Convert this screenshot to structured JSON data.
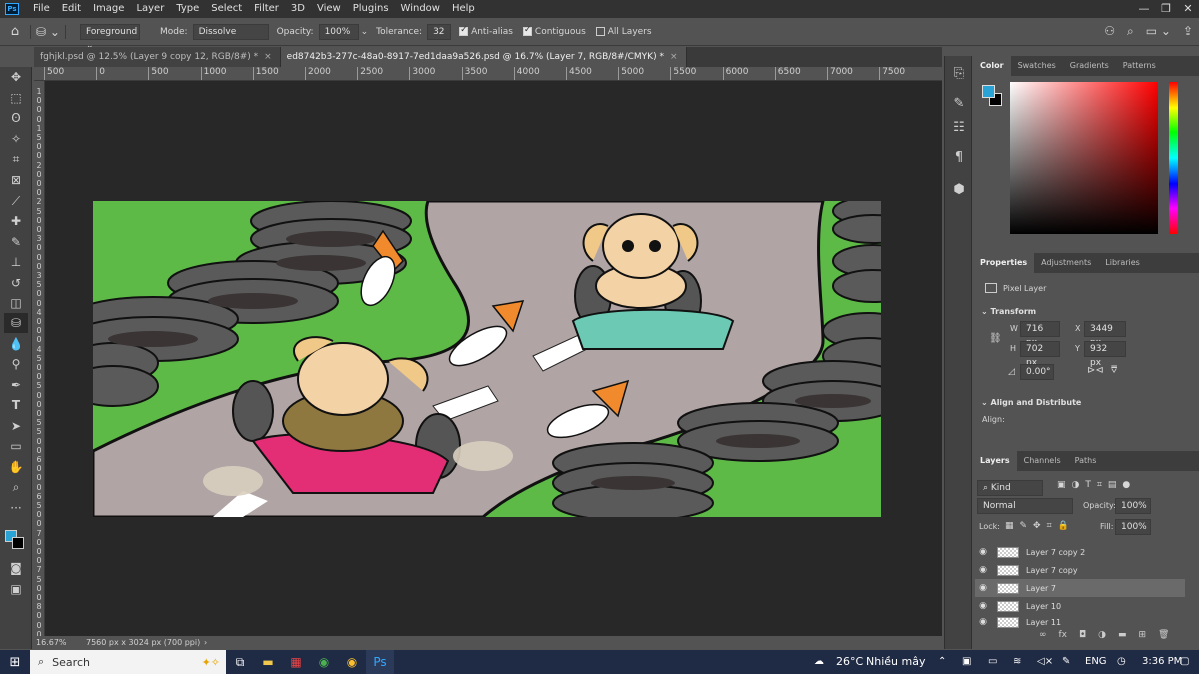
{
  "menu": {
    "logo": "Ps",
    "items": [
      "File",
      "Edit",
      "Image",
      "Layer",
      "Type",
      "Select",
      "Filter",
      "3D",
      "View",
      "Plugins",
      "Window",
      "Help"
    ],
    "window_controls": [
      "—",
      "❐",
      "✕"
    ]
  },
  "options": {
    "fill_source": "Foreground",
    "mode_label": "Mode:",
    "mode_value": "Dissolve",
    "opacity_label": "Opacity:",
    "opacity_value": "100%",
    "tolerance_label": "Tolerance:",
    "tolerance_value": "32",
    "anti_alias": "Anti-alias",
    "contiguous": "Contiguous",
    "all_layers": "All Layers"
  },
  "tabs": [
    {
      "label": "fghjkl.psd @ 12.5% (Layer 9 copy 12, RGB/8#) *",
      "close": "×"
    },
    {
      "label": "ed8742b3-277c-48a0-8917-7ed1daa9a526.psd @ 16.7% (Layer 7, RGB/8#/CMYK) *",
      "close": "×"
    }
  ],
  "ruler": {
    "h_ticks": [
      "500",
      "0",
      "500",
      "1000",
      "1500",
      "2000",
      "2500",
      "3000",
      "3500",
      "4000",
      "4500",
      "5000",
      "5500",
      "6000",
      "6500",
      "7000",
      "7500"
    ],
    "v_ticks": [
      "1",
      "0",
      "0",
      "0",
      "1",
      "5",
      "0",
      "0",
      "2",
      "0",
      "0",
      "0",
      "2",
      "5",
      "0",
      "0",
      "3",
      "0",
      "0",
      "0",
      "3",
      "5",
      "0",
      "0",
      "4",
      "0",
      "0",
      "0",
      "4",
      "5",
      "0",
      "0",
      "5",
      "0",
      "0",
      "0",
      "5",
      "5",
      "0",
      "0",
      "6",
      "0",
      "0",
      "0",
      "6",
      "5",
      "0",
      "0",
      "7",
      "0",
      "0",
      "0",
      "7",
      "5",
      "0",
      "0",
      "8",
      "0",
      "0",
      "0"
    ]
  },
  "status": {
    "zoom": "16.67%",
    "doc_size": "7560 px x 3024 px (700 ppi)",
    "arrow": "›"
  },
  "color_panel": {
    "tabs": [
      "Color",
      "Swatches",
      "Gradients",
      "Patterns"
    ],
    "fg_color": "#29a3d6",
    "bg_color": "#000000"
  },
  "properties": {
    "tabs": [
      "Properties",
      "Adjustments",
      "Libraries"
    ],
    "kind": "Pixel Layer",
    "transform_label": "Transform",
    "w_label": "W",
    "w_value": "716 px",
    "x_label": "X",
    "x_value": "3449 px",
    "h_label": "H",
    "h_value": "702 px",
    "y_label": "Y",
    "y_value": "932 px",
    "angle": "0.00°",
    "align_label": "Align and Distribute",
    "align_sub": "Align:"
  },
  "layers_panel": {
    "tabs": [
      "Layers",
      "Channels",
      "Paths"
    ],
    "filter_kind": "Kind",
    "blend_mode": "Normal",
    "opacity_label": "Opacity:",
    "opacity_value": "100%",
    "lock_label": "Lock:",
    "fill_label": "Fill:",
    "fill_value": "100%",
    "layers": [
      {
        "name": "Layer 7 copy 2"
      },
      {
        "name": "Layer 7 copy"
      },
      {
        "name": "Layer 7"
      },
      {
        "name": "Layer 10"
      },
      {
        "name": "Layer 11"
      }
    ],
    "footer_icons": [
      "∞",
      "fx"
    ]
  },
  "taskbar": {
    "search_placeholder": "Search",
    "weather_temp": "26°C",
    "weather_text": "Nhiều mây",
    "lang": "ENG",
    "time": "3:36 PM"
  },
  "icons": {
    "layer_visible": "👁",
    "dropdown": "⌄"
  }
}
